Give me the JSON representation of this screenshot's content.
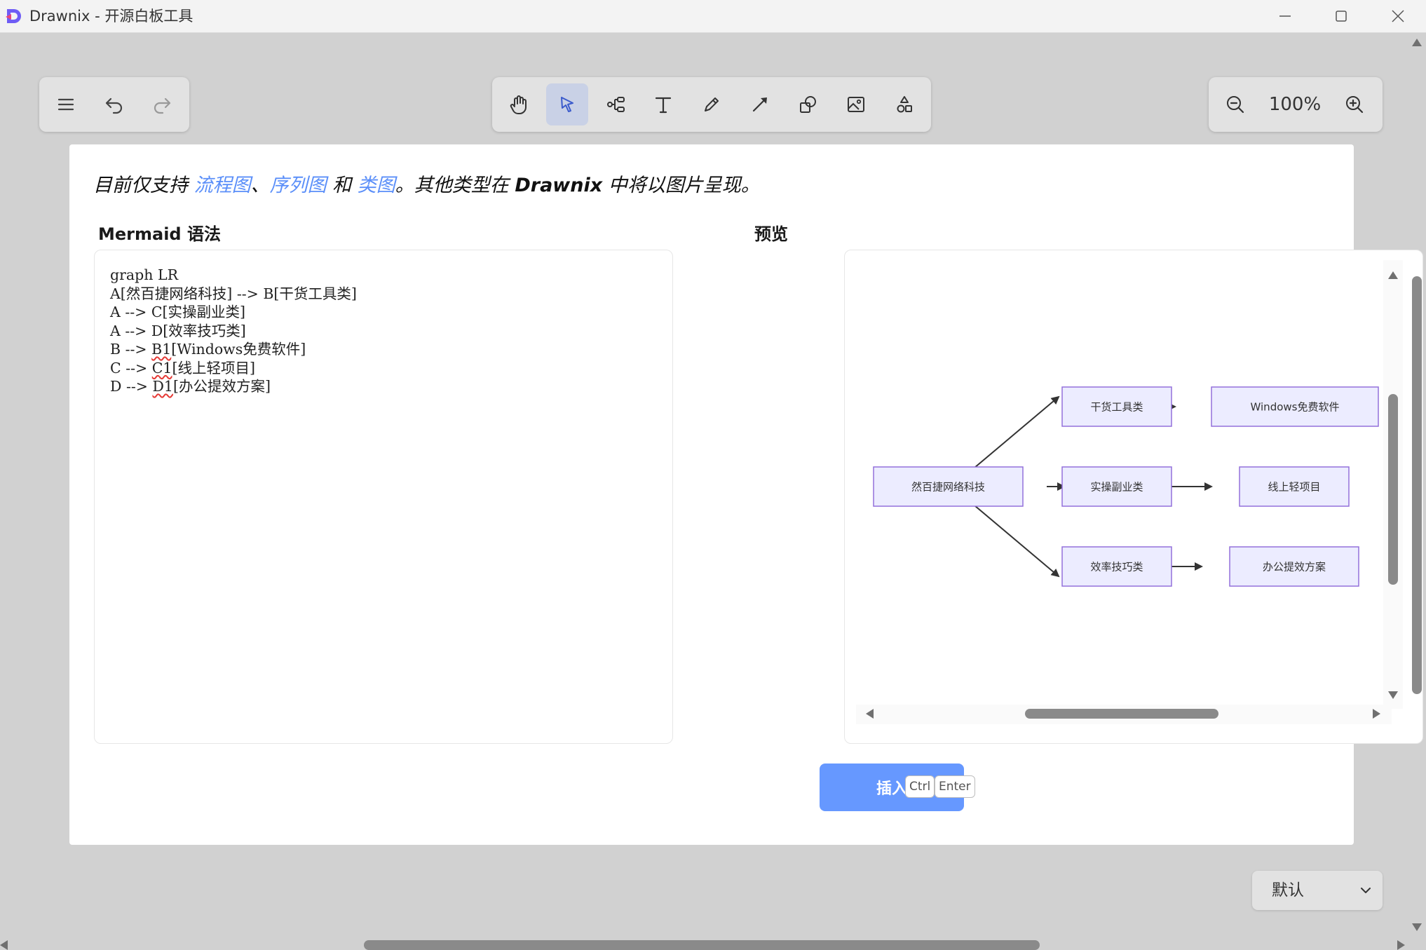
{
  "window": {
    "title": "Drawnix - 开源白板工具",
    "controls": [
      "minimize-icon",
      "maximize-icon",
      "close-icon"
    ]
  },
  "left_toolbar": {
    "items": [
      {
        "name": "menu-icon"
      },
      {
        "name": "undo-icon"
      },
      {
        "name": "redo-icon"
      }
    ]
  },
  "main_toolbar": {
    "items": [
      {
        "name": "hand-icon"
      },
      {
        "name": "pointer-icon",
        "active": true
      },
      {
        "name": "mindmap-icon"
      },
      {
        "name": "text-icon"
      },
      {
        "name": "pen-icon"
      },
      {
        "name": "arrow-icon"
      },
      {
        "name": "shape-icon"
      },
      {
        "name": "image-icon"
      },
      {
        "name": "extra-tools-icon"
      }
    ]
  },
  "zoom": {
    "value": "100%",
    "zoom_out_icon": "zoom-out-icon",
    "zoom_in_icon": "zoom-in-icon"
  },
  "dialog": {
    "notice": {
      "prefix": "目前仅支持 ",
      "link1": "流程图",
      "sep1": "、",
      "link2": "序列图",
      "mid": " 和 ",
      "link3": "类图",
      "suffix_a": "。其他类型在 ",
      "brand": "Drawnix",
      "suffix_b": " 中将以图片呈现。"
    },
    "syntax_title": "Mermaid 语法",
    "preview_title": "预览",
    "code": {
      "l1": "graph LR",
      "l2": "A[然百捷网络科技] --> B[干货工具类]",
      "l3": "A --> C[实操副业类]",
      "l4": "A --> D[效率技巧类]",
      "l5a": "B --> ",
      "l5b": "B1",
      "l5c": "[Windows免费软件]",
      "l6a": "C --> ",
      "l6b": "C1",
      "l6c": "[线上轻项目]",
      "l7a": "D --> ",
      "l7b": "D1",
      "l7c": "[办公提效方案]"
    },
    "diagram": {
      "nodes": {
        "A": "然百捷网络科技",
        "B": "干货工具类",
        "C": "实操副业类",
        "D": "效率技巧类",
        "B1": "Windows免费软件",
        "C1": "线上轻项目",
        "D1": "办公提效方案"
      }
    },
    "insert_button": "插入",
    "shortcut_keys": [
      "Ctrl",
      "Enter"
    ]
  },
  "theme_select": {
    "value": "默认"
  },
  "colors": {
    "accent": "#6698ff",
    "link": "#5b8ff9",
    "node_fill": "#ececff",
    "node_stroke": "#9370db",
    "canvas_bg": "#d1d1d1"
  }
}
